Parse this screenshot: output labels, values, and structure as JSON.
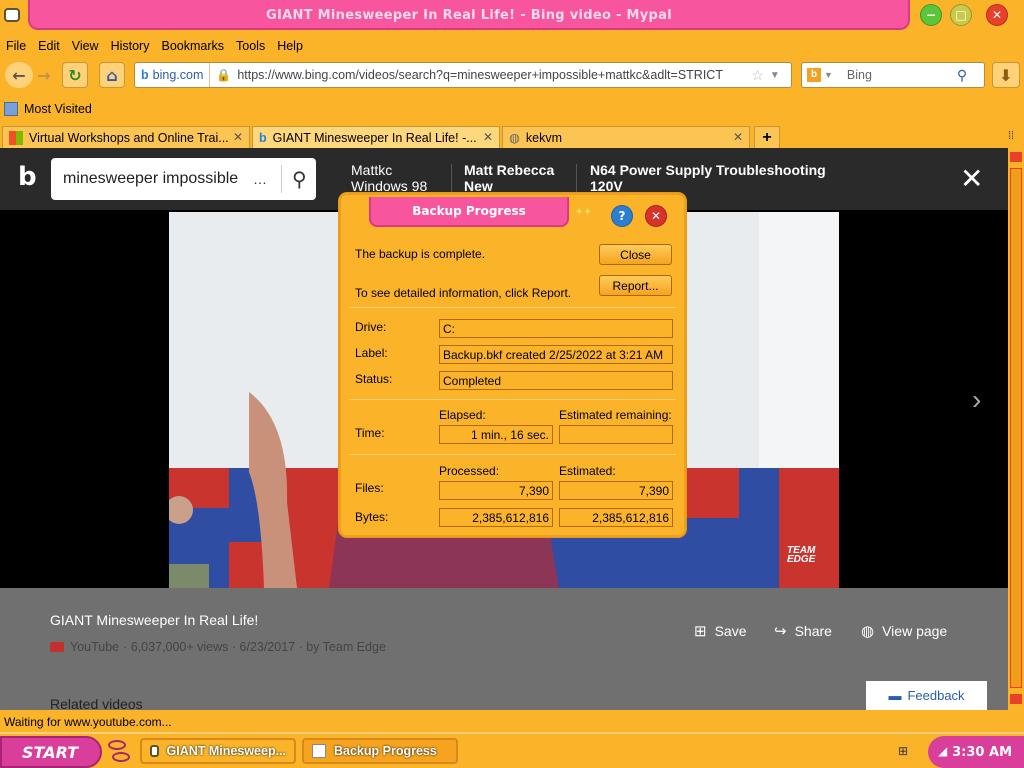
{
  "window": {
    "title": "GIANT Minesweeper In Real Life! - Bing video - Mypal"
  },
  "menu": [
    "File",
    "Edit",
    "View",
    "History",
    "Bookmarks",
    "Tools",
    "Help"
  ],
  "nav": {
    "site": "bing.com",
    "url": "https://www.bing.com/videos/search?q=minesweeper+impossible+mattkc&adlt=STRICT",
    "search_placeholder": "Bing"
  },
  "bookmarks": {
    "most_visited": "Most Visited"
  },
  "tabs": [
    {
      "label": "Virtual Workshops and Online Trai..."
    },
    {
      "label": "GIANT Minesweeper In Real Life! -..."
    },
    {
      "label": "kekvm"
    }
  ],
  "bing": {
    "search_value": "minesweeper impossible",
    "related": [
      {
        "line1": "Mattkc",
        "line2": "Windows 98"
      },
      {
        "line1": "Matt Rebecca",
        "line2": "New"
      },
      {
        "line1": "N64 Power Supply Troubleshooting",
        "line2": "120V"
      }
    ],
    "video_badge": "TEAM EDGE",
    "video_title": "GIANT Minesweeper In Real Life!",
    "source": "YouTube",
    "meta": "· 6,037,000+ views · 6/23/2017 · by Team Edge",
    "actions": {
      "save": "Save",
      "share": "Share",
      "view_page": "View page"
    },
    "related_heading": "Related videos",
    "feedback": "Feedback"
  },
  "dialog": {
    "title": "Backup Progress",
    "message": "The backup is complete.",
    "report_hint": "To see detailed information, click Report.",
    "close_btn": "Close",
    "report_btn": "Report...",
    "drive_label": "Drive:",
    "drive": "C:",
    "label_label": "Label:",
    "label": "Backup.bkf created 2/25/2022 at 3:21 AM",
    "status_label": "Status:",
    "status": "Completed",
    "elapsed_header": "Elapsed:",
    "remaining_header": "Estimated remaining:",
    "time_label": "Time:",
    "elapsed": "1 min., 16 sec.",
    "remaining": "",
    "processed_header": "Processed:",
    "estimated_header": "Estimated:",
    "files_label": "Files:",
    "files_processed": "7,390",
    "files_estimated": "7,390",
    "bytes_label": "Bytes:",
    "bytes_processed": "2,385,612,816",
    "bytes_estimated": "2,385,612,816"
  },
  "status_bar": "Waiting for www.youtube.com...",
  "taskbar": {
    "start": "START",
    "items": [
      "GIANT Minesweep...",
      "Backup Progress"
    ],
    "clock": "3:30 AM"
  },
  "colors": {
    "theme_orange": "#fbb429",
    "title_pink": "#f7569f",
    "start_magenta": "#d93f9a"
  }
}
